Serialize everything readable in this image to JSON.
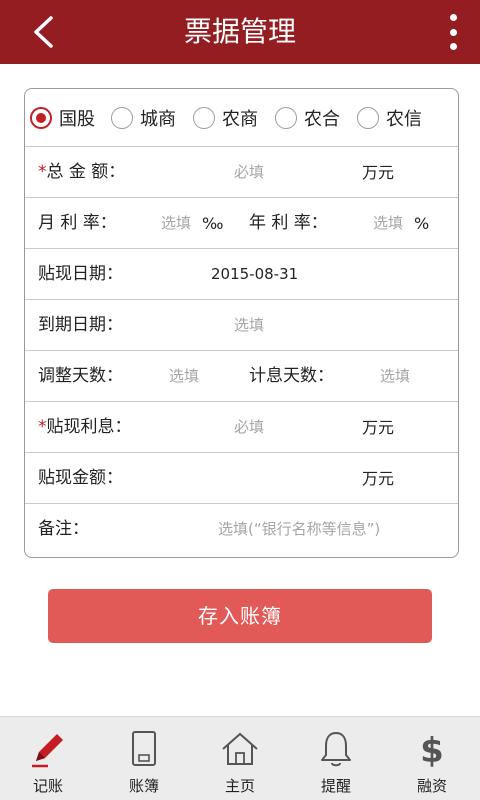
{
  "header": {
    "title": "票据管理",
    "back_icon": "chevron-left-icon",
    "menu_icon": "more-vertical-icon",
    "bg_color": "#931d21"
  },
  "bank_types": {
    "options": [
      "国股",
      "城商",
      "农商",
      "农合",
      "农信"
    ],
    "selected": "国股"
  },
  "form": {
    "total_amount": {
      "required_mark": "*",
      "label": "总 金 额：",
      "placeholder": "必填",
      "unit": "万元"
    },
    "monthly_rate": {
      "label": "月 利 率：",
      "placeholder": "选填",
      "unit": "‰"
    },
    "annual_rate": {
      "label": "年 利 率：",
      "placeholder": "选填",
      "unit": "%"
    },
    "discount_date": {
      "label": "贴现日期：",
      "value": "2015-08-31"
    },
    "due_date": {
      "label": "到期日期：",
      "placeholder": "选填"
    },
    "adjust_days": {
      "label": "调整天数：",
      "placeholder": "选填"
    },
    "interest_days": {
      "label": "计息天数：",
      "placeholder": "选填"
    },
    "discount_interest": {
      "required_mark": "*",
      "label": "贴现利息：",
      "placeholder": "必填",
      "unit": "万元"
    },
    "discount_amount": {
      "label": "贴现金额：",
      "unit": "万元"
    },
    "remark": {
      "label": "备注：",
      "placeholder": "选填(“银行名称等信息”)"
    }
  },
  "submit": {
    "label": "存入账簿",
    "color": "#e25a57"
  },
  "tabbar": {
    "items": [
      {
        "label": "记账",
        "icon": "pencil-icon",
        "active": true
      },
      {
        "label": "账簿",
        "icon": "ledger-book-icon",
        "active": false
      },
      {
        "label": "主页",
        "icon": "home-icon",
        "active": false
      },
      {
        "label": "提醒",
        "icon": "bell-icon",
        "active": false
      },
      {
        "label": "融资",
        "icon": "dollar-icon",
        "active": false
      }
    ]
  }
}
